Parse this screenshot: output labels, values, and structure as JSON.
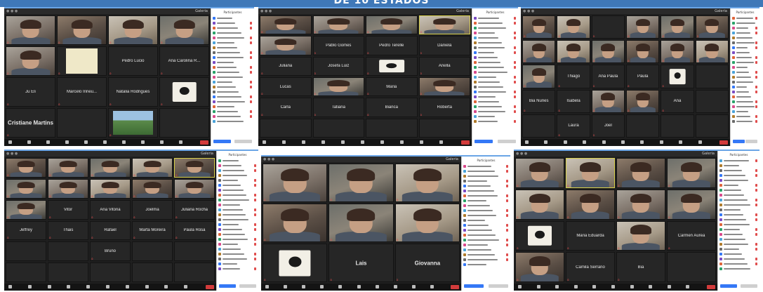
{
  "banner": {
    "text": "DE 10 ESTADOS"
  },
  "colors": {
    "banner": "#3f78b8",
    "leave_button": "#d23b3b",
    "meeting_bg": "#1f1f1f",
    "speaker_border": "#d8d04a",
    "panel_button": "#3478f6"
  },
  "screenshots": [
    {
      "id": "s1",
      "view_label": "Galeria",
      "panel_title": "Participantes",
      "rows": 4,
      "cols": 4,
      "tiles": [
        {
          "kind": "video",
          "v": "v2",
          "label": ""
        },
        {
          "kind": "video",
          "v": "v1",
          "label": ""
        },
        {
          "kind": "video",
          "v": "v4",
          "label": ""
        },
        {
          "kind": "video",
          "v": "v3",
          "label": ""
        },
        {
          "kind": "video",
          "v": "v2",
          "label": ""
        },
        {
          "kind": "sketch",
          "label": ""
        },
        {
          "kind": "name",
          "name": "Pedro Lucio",
          "label": ""
        },
        {
          "kind": "name",
          "name": "Ana Carolina R...",
          "label": ""
        },
        {
          "kind": "name",
          "name": "Ju Eli",
          "label": ""
        },
        {
          "kind": "name",
          "name": "Marcelo Irineu...",
          "label": ""
        },
        {
          "kind": "name",
          "name": "Natalia Rodrigues",
          "label": ""
        },
        {
          "kind": "cartoon",
          "label": ""
        },
        {
          "kind": "name",
          "name": "Cristiane Martins",
          "big": true,
          "label": ""
        },
        {
          "kind": "empty",
          "label": ""
        },
        {
          "kind": "landscape",
          "label": ""
        },
        {
          "kind": "empty",
          "label": ""
        }
      ]
    },
    {
      "id": "s2",
      "view_label": "Galeria",
      "panel_title": "Participantes",
      "rows": 6,
      "cols": 4,
      "tiles": [
        {
          "kind": "video",
          "v": "v1",
          "label": ""
        },
        {
          "kind": "video",
          "v": "v2",
          "label": ""
        },
        {
          "kind": "video",
          "v": "v3",
          "label": ""
        },
        {
          "kind": "video",
          "v": "v4",
          "label": "",
          "talking": true
        },
        {
          "kind": "video",
          "v": "v2",
          "label": ""
        },
        {
          "kind": "name",
          "name": "Pablo Gomes",
          "label": ""
        },
        {
          "kind": "name",
          "name": "Pedro Terelle",
          "label": ""
        },
        {
          "kind": "name",
          "name": "Daniela",
          "label": ""
        },
        {
          "kind": "name",
          "name": "Juliana",
          "label": ""
        },
        {
          "kind": "name",
          "name": "Josefa Luiz",
          "label": ""
        },
        {
          "kind": "cartoon",
          "label": ""
        },
        {
          "kind": "name",
          "name": "Ariella",
          "label": ""
        },
        {
          "kind": "name",
          "name": "Lucas",
          "label": ""
        },
        {
          "kind": "video",
          "v": "v3",
          "label": ""
        },
        {
          "kind": "name",
          "name": "Maria",
          "label": ""
        },
        {
          "kind": "video",
          "v": "v1",
          "label": ""
        },
        {
          "kind": "name",
          "name": "Carla",
          "label": ""
        },
        {
          "kind": "name",
          "name": "Tatiana",
          "label": ""
        },
        {
          "kind": "name",
          "name": "Bianca",
          "label": ""
        },
        {
          "kind": "name",
          "name": "Roberta",
          "label": ""
        },
        {
          "kind": "empty",
          "label": ""
        },
        {
          "kind": "empty",
          "label": ""
        },
        {
          "kind": "empty",
          "label": ""
        },
        {
          "kind": "empty",
          "label": ""
        }
      ]
    },
    {
      "id": "s3",
      "view_label": "Galeria",
      "panel_title": "Participantes",
      "rows": 5,
      "cols": 6,
      "tiles": [
        {
          "kind": "video",
          "v": "v1",
          "label": ""
        },
        {
          "kind": "video",
          "v": "v4",
          "label": ""
        },
        {
          "kind": "name",
          "name": "",
          "label": ""
        },
        {
          "kind": "video",
          "v": "v2",
          "label": ""
        },
        {
          "kind": "video",
          "v": "v3",
          "label": ""
        },
        {
          "kind": "video",
          "v": "v1",
          "label": ""
        },
        {
          "kind": "video",
          "v": "v2",
          "label": ""
        },
        {
          "kind": "video",
          "v": "v4",
          "label": ""
        },
        {
          "kind": "video",
          "v": "v3",
          "label": ""
        },
        {
          "kind": "video",
          "v": "v1",
          "label": ""
        },
        {
          "kind": "video",
          "v": "v2",
          "label": ""
        },
        {
          "kind": "video",
          "v": "v4",
          "label": ""
        },
        {
          "kind": "video",
          "v": "v3",
          "label": ""
        },
        {
          "kind": "name",
          "name": "Thiago",
          "label": ""
        },
        {
          "kind": "name",
          "name": "Ana Paula",
          "label": ""
        },
        {
          "kind": "name",
          "name": "Paula",
          "label": ""
        },
        {
          "kind": "cartoon",
          "label": ""
        },
        {
          "kind": "empty",
          "label": ""
        },
        {
          "kind": "name",
          "name": "Bia Nunes",
          "label": ""
        },
        {
          "kind": "name",
          "name": "Isabela",
          "label": ""
        },
        {
          "kind": "video",
          "v": "v2",
          "label": ""
        },
        {
          "kind": "video",
          "v": "v1",
          "label": ""
        },
        {
          "kind": "name",
          "name": "Ana",
          "label": ""
        },
        {
          "kind": "empty",
          "label": ""
        },
        {
          "kind": "empty",
          "label": ""
        },
        {
          "kind": "name",
          "name": "Laura",
          "label": ""
        },
        {
          "kind": "name",
          "name": "Joel",
          "label": ""
        },
        {
          "kind": "empty",
          "label": ""
        },
        {
          "kind": "empty",
          "label": ""
        },
        {
          "kind": "empty",
          "label": ""
        }
      ]
    },
    {
      "id": "s4",
      "view_label": "Galeria",
      "panel_title": "Participantes",
      "rows": 6,
      "cols": 5,
      "tiles": [
        {
          "kind": "video",
          "v": "v1",
          "label": ""
        },
        {
          "kind": "video",
          "v": "v2",
          "label": ""
        },
        {
          "kind": "video",
          "v": "v3",
          "label": ""
        },
        {
          "kind": "video",
          "v": "v4",
          "label": ""
        },
        {
          "kind": "video",
          "v": "v1",
          "label": "",
          "talking": true
        },
        {
          "kind": "video",
          "v": "v3",
          "label": ""
        },
        {
          "kind": "video",
          "v": "v2",
          "label": ""
        },
        {
          "kind": "video",
          "v": "v4",
          "label": ""
        },
        {
          "kind": "video",
          "v": "v1",
          "label": ""
        },
        {
          "kind": "video",
          "v": "v2",
          "label": ""
        },
        {
          "kind": "video",
          "v": "v3",
          "label": ""
        },
        {
          "kind": "name",
          "name": "Vitor",
          "label": ""
        },
        {
          "kind": "name",
          "name": "Ana Vitoria",
          "label": ""
        },
        {
          "kind": "name",
          "name": "Joelma",
          "label": ""
        },
        {
          "kind": "name",
          "name": "Juliana Rocha",
          "label": ""
        },
        {
          "kind": "name",
          "name": "Jeffrey",
          "label": ""
        },
        {
          "kind": "name",
          "name": "Thais",
          "label": ""
        },
        {
          "kind": "name",
          "name": "Rafael",
          "label": ""
        },
        {
          "kind": "name",
          "name": "Marta Moreira",
          "label": ""
        },
        {
          "kind": "name",
          "name": "Paula Rosa",
          "label": ""
        },
        {
          "kind": "empty",
          "label": ""
        },
        {
          "kind": "empty",
          "label": ""
        },
        {
          "kind": "name",
          "name": "Bruno",
          "label": ""
        },
        {
          "kind": "empty",
          "label": ""
        },
        {
          "kind": "empty",
          "label": ""
        },
        {
          "kind": "empty",
          "label": ""
        },
        {
          "kind": "empty",
          "label": ""
        },
        {
          "kind": "empty",
          "label": ""
        },
        {
          "kind": "empty",
          "label": ""
        },
        {
          "kind": "empty",
          "label": ""
        }
      ]
    },
    {
      "id": "s5",
      "view_label": "Galeria",
      "panel_title": "Participantes",
      "rows": 3,
      "cols": 3,
      "tiles": [
        {
          "kind": "video",
          "v": "v2",
          "label": ""
        },
        {
          "kind": "video",
          "v": "v3",
          "label": ""
        },
        {
          "kind": "video",
          "v": "v4",
          "label": ""
        },
        {
          "kind": "video",
          "v": "v1",
          "label": ""
        },
        {
          "kind": "video",
          "v": "v3",
          "label": ""
        },
        {
          "kind": "video",
          "v": "v4",
          "label": ""
        },
        {
          "kind": "cartoon",
          "label": ""
        },
        {
          "kind": "name",
          "name": "Lais",
          "big": true,
          "label": ""
        },
        {
          "kind": "name",
          "name": "Giovanna",
          "big": true,
          "label": ""
        }
      ]
    },
    {
      "id": "s6",
      "view_label": "Galeria",
      "panel_title": "Participantes",
      "rows": 4,
      "cols": 4,
      "tiles": [
        {
          "kind": "video",
          "v": "v2",
          "label": ""
        },
        {
          "kind": "video",
          "v": "v4",
          "label": "",
          "talking": true
        },
        {
          "kind": "video",
          "v": "v1",
          "label": ""
        },
        {
          "kind": "video",
          "v": "v3",
          "label": ""
        },
        {
          "kind": "video",
          "v": "v4",
          "label": ""
        },
        {
          "kind": "video",
          "v": "v1",
          "label": ""
        },
        {
          "kind": "video",
          "v": "v2",
          "label": ""
        },
        {
          "kind": "video",
          "v": "v3",
          "label": ""
        },
        {
          "kind": "cartoon",
          "label": ""
        },
        {
          "kind": "name",
          "name": "Maria Eduarda",
          "label": ""
        },
        {
          "kind": "video",
          "v": "v4",
          "label": ""
        },
        {
          "kind": "name",
          "name": "Carmen Aurea",
          "label": ""
        },
        {
          "kind": "video",
          "v": "v1",
          "label": ""
        },
        {
          "kind": "name",
          "name": "Camila Serrano",
          "label": ""
        },
        {
          "kind": "name",
          "name": "Bia",
          "label": ""
        },
        {
          "kind": "empty",
          "label": ""
        }
      ]
    }
  ]
}
